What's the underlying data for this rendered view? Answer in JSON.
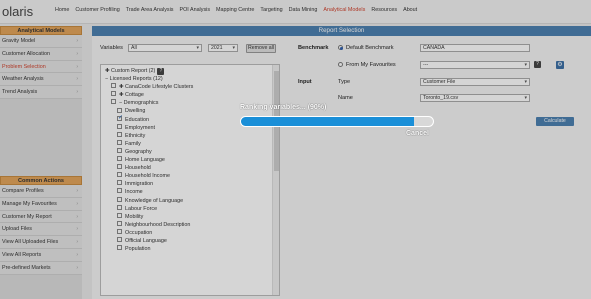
{
  "app": {
    "logo": "olaris"
  },
  "nav": [
    "Home",
    "Customer Profiling",
    "Trade Area Analysis",
    "POI Analysis",
    "Mapping Centre",
    "Targeting",
    "Data Mining",
    "Analytical Models",
    "Resources",
    "About"
  ],
  "sidebar": {
    "models_title": "Analytical Models",
    "models": [
      "Gravity Model",
      "Customer Allocation",
      "Problem Selection",
      "Weather Analysis",
      "Trend Analysis"
    ],
    "actions_title": "Common Actions",
    "actions": [
      "Compare Profiles",
      "Manage My Favourites",
      "Customer My Report",
      "Upload Files",
      "View All Uploaded Files",
      "View All Reports",
      "Pre-defined Markets"
    ]
  },
  "report": {
    "title": "Report Selection",
    "variables_label": "Variables",
    "variables_value": "All",
    "year_value": "2021",
    "remove_all": "Remove all",
    "benchmark_label": "Benchmark",
    "default_benchmark": "Default Benchmark",
    "benchmark_value": "CANADA",
    "from_favourites": "From My Favourites",
    "favourites_value": "---",
    "input_label": "Input",
    "type_label": "Type",
    "type_value": "Customer File",
    "name_label": "Name",
    "name_value": "Toronto_19.csv",
    "calculate": "Calculate",
    "help": "?",
    "gear": "⚙"
  },
  "tree": {
    "custom_report": "Custom Report (2)",
    "licensed_reports": "Licensed Reports (12)",
    "canacode": "CanaCode Lifestyle Clusters",
    "cottage": "Cottage",
    "demographics": "Demographics",
    "items": [
      "Dwelling",
      "Education",
      "Employment",
      "Ethnicity",
      "Family",
      "Geography",
      "Home Language",
      "Household",
      "Household Income",
      "Immigration",
      "Income",
      "Knowledge of Language",
      "Labour Force",
      "Mobility",
      "Neighbourhood Description",
      "Occupation",
      "Official Language",
      "Population"
    ],
    "checked_item": "Education"
  },
  "progress": {
    "message": "Ranking variables... (90%)",
    "percent": 90,
    "cancel": "Cancel"
  }
}
